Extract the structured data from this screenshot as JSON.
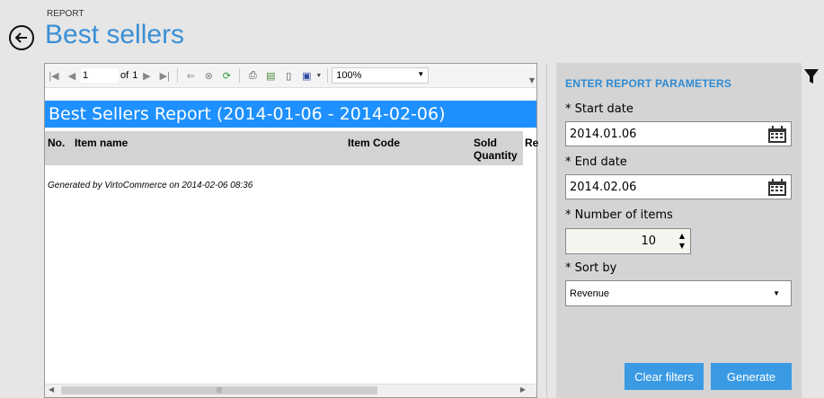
{
  "breadcrumb": "REPORT",
  "page_title": "Best sellers",
  "viewer": {
    "page_current": "1",
    "page_of": "of",
    "page_total": "1",
    "zoom": "100%",
    "report_title": "Best Sellers Report (2014-01-06 - 2014-02-06)",
    "columns": [
      "No.",
      "Item name",
      "Item Code",
      "Sold",
      "Quantity",
      "Re"
    ],
    "generated_text": "Generated by VirtoCommerce on 2014-02-06 08:36"
  },
  "params": {
    "title": "ENTER REPORT PARAMETERS",
    "start_label": "* Start date",
    "start_value": "2014.01.06",
    "end_label": "* End date",
    "end_value": "2014.02.06",
    "items_label": "* Number of items",
    "items_value": "10",
    "sort_label": "* Sort by",
    "sort_value": "Revenue",
    "clear_label": "Clear filters",
    "generate_label": "Generate"
  },
  "colors": {
    "accent": "#3a8fd6",
    "report_header": "#1e90ff",
    "button": "#3a9ae3"
  }
}
